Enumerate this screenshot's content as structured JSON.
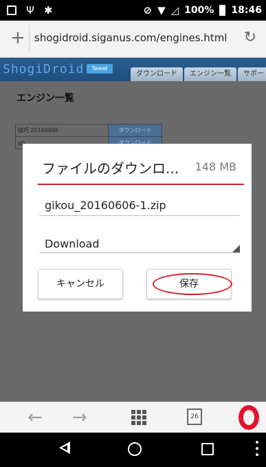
{
  "status_bar": {
    "battery": "100%",
    "time": "18:46"
  },
  "address_bar": {
    "url": "shogidroid.siganus.com/engines.html"
  },
  "site": {
    "logo": "ShogiDroid",
    "tweet_label": "Tweet",
    "nav": [
      "ダウンロード",
      "エンジン一覧",
      "サポー"
    ],
    "heading": "エンジン一覧",
    "table_rows": [
      {
        "name": "技巧 20160606",
        "action": "ダウンロード"
      },
      {
        "name": "gp...",
        "action": "ダウンロード"
      }
    ]
  },
  "dialog": {
    "title": "ファイルのダウンロ...",
    "size": "148 MB",
    "filename": "gikou_20160606-1.zip",
    "folder": "Download",
    "cancel_label": "キャンセル",
    "save_label": "保存"
  },
  "toolbar": {
    "tab_count": "26"
  },
  "colors": {
    "accent": "#c62828",
    "annotation": "#d51f2a",
    "opera": "#e0142d"
  }
}
